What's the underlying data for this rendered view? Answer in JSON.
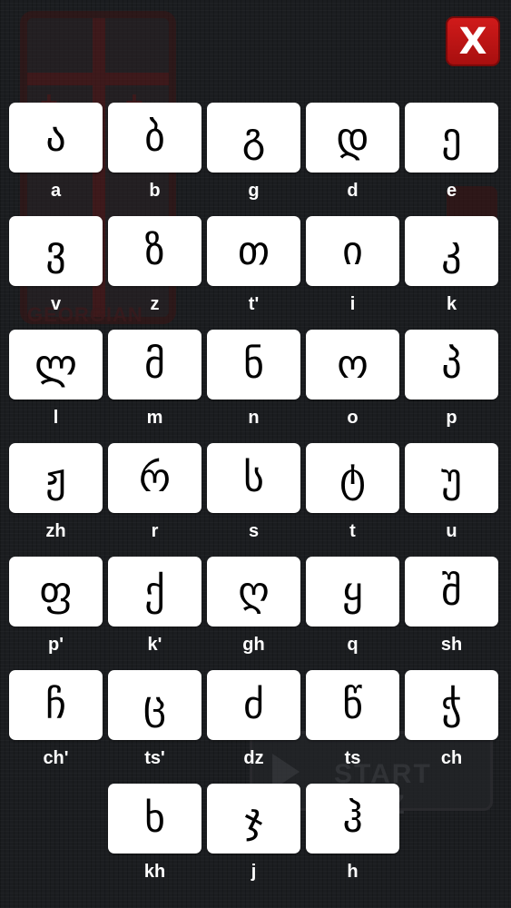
{
  "close_button": {
    "label": "X"
  },
  "background": {
    "title": "GEORGIAN",
    "quiz_label": "START QUIZ"
  },
  "colors": {
    "background": "#1b1d20",
    "tile": "#ffffff",
    "close_button": "#c0141a",
    "text": "#ffffff"
  },
  "letters": [
    {
      "glyph": "ა",
      "translit": "a"
    },
    {
      "glyph": "ბ",
      "translit": "b"
    },
    {
      "glyph": "გ",
      "translit": "g"
    },
    {
      "glyph": "დ",
      "translit": "d"
    },
    {
      "glyph": "ე",
      "translit": "e"
    },
    {
      "glyph": "ვ",
      "translit": "v"
    },
    {
      "glyph": "ზ",
      "translit": "z"
    },
    {
      "glyph": "თ",
      "translit": "t'"
    },
    {
      "glyph": "ი",
      "translit": "i"
    },
    {
      "glyph": "კ",
      "translit": "k"
    },
    {
      "glyph": "ლ",
      "translit": "l"
    },
    {
      "glyph": "მ",
      "translit": "m"
    },
    {
      "glyph": "ნ",
      "translit": "n"
    },
    {
      "glyph": "ო",
      "translit": "o"
    },
    {
      "glyph": "პ",
      "translit": "p"
    },
    {
      "glyph": "ჟ",
      "translit": "zh"
    },
    {
      "glyph": "რ",
      "translit": "r"
    },
    {
      "glyph": "ს",
      "translit": "s"
    },
    {
      "glyph": "ტ",
      "translit": "t"
    },
    {
      "glyph": "უ",
      "translit": "u"
    },
    {
      "glyph": "ფ",
      "translit": "p'"
    },
    {
      "glyph": "ქ",
      "translit": "k'"
    },
    {
      "glyph": "ღ",
      "translit": "gh"
    },
    {
      "glyph": "ყ",
      "translit": "q"
    },
    {
      "glyph": "შ",
      "translit": "sh"
    },
    {
      "glyph": "ჩ",
      "translit": "ch'"
    },
    {
      "glyph": "ც",
      "translit": "ts'"
    },
    {
      "glyph": "ძ",
      "translit": "dz"
    },
    {
      "glyph": "წ",
      "translit": "ts"
    },
    {
      "glyph": "ჭ",
      "translit": "ch"
    },
    {
      "glyph": "ხ",
      "translit": "kh"
    },
    {
      "glyph": "ჯ",
      "translit": "j"
    },
    {
      "glyph": "ჰ",
      "translit": "h"
    }
  ]
}
